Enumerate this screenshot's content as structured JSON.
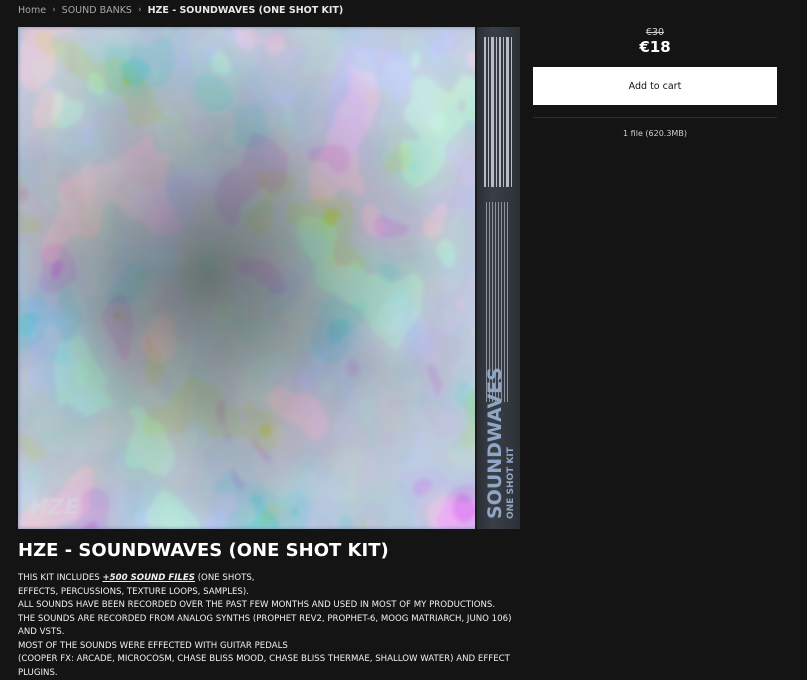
{
  "breadcrumb": {
    "items": [
      "Home",
      "SOUND BANKS",
      "HZE - SOUNDWAVES (ONE SHOT KIT)"
    ],
    "separator": "›"
  },
  "cover": {
    "spine_title": "SOUNDWAVES",
    "spine_subtitle": "ONE SHOT KIT",
    "logo": "HZE",
    "colors": {
      "water": "#7c8fae",
      "weed": "#36472c",
      "spine": "#2f343b"
    }
  },
  "pricing": {
    "old_price": "€30",
    "new_price": "€18",
    "add_to_cart": "Add to cart",
    "file_info": "1 file (620.3MB)"
  },
  "product": {
    "title": "HZE - SOUNDWAVES (ONE SHOT KIT)",
    "description": {
      "line1_prefix": "THIS KIT INCLUDES ",
      "line1_highlight": "+500 SOUND FILES",
      "line1_suffix": " (ONE SHOTS,",
      "line2": "EFFECTS, PERCUSSIONS, TEXTURE LOOPS, SAMPLES).",
      "line3": "ALL SOUNDS HAVE BEEN RECORDED OVER THE PAST FEW MONTHS AND USED IN MOST OF MY PRODUCTIONS.",
      "line4": "THE SOUNDS ARE RECORDED FROM ANALOG SYNTHS (PROPHET REV2, PROPHET-6, MOOG MATRIARCH, JUNO 106)",
      "line5": "AND VSTS.",
      "line6": "MOST OF THE SOUNDS WERE EFFECTED WITH GUITAR PEDALS",
      "line7": "(COOPER FX: ARCADE, MICROCOSM, CHASE BLISS MOOD, CHASE BLISS THERMAE, SHALLOW WATER) AND EFFECT",
      "line8": "PLUGINS."
    }
  }
}
